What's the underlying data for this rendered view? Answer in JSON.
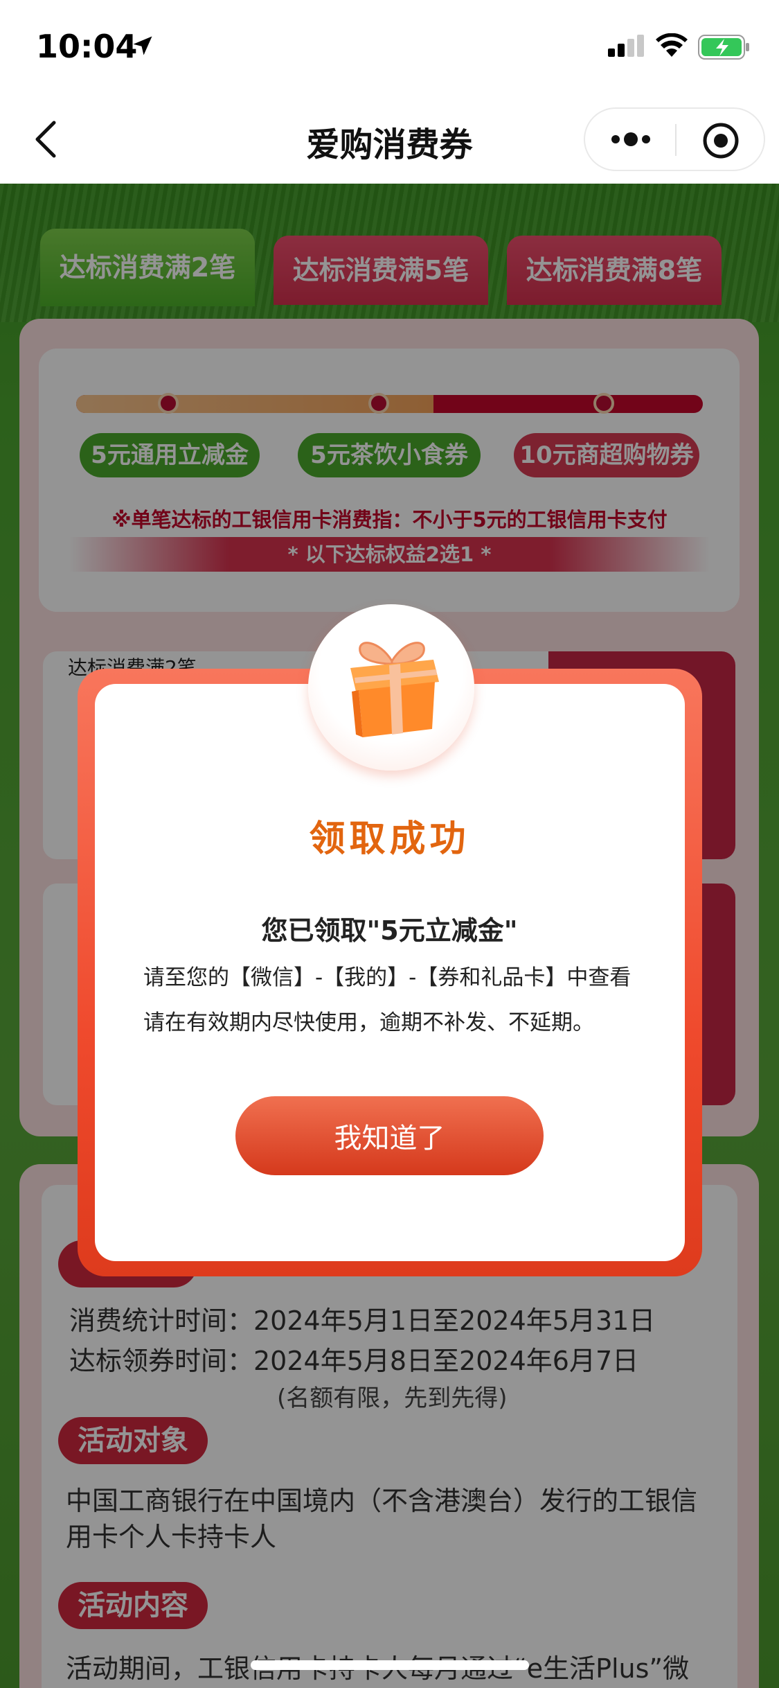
{
  "status": {
    "time": "10:04"
  },
  "nav": {
    "title": "爱购消费券"
  },
  "tabs": [
    {
      "label": "达标消费满2笔"
    },
    {
      "label": "达标消费满5笔"
    },
    {
      "label": "达标消费满8笔"
    }
  ],
  "rewards": {
    "pills": [
      "5元通用立减金",
      "5元茶饮小食券",
      "10元商超购物券"
    ],
    "progress_fraction": 0.57,
    "note": "※单笔达标的工银信用卡消费指：不小于5元的工银信用卡支付",
    "choose": "* 以下达标权益2选1 *",
    "card_title": "达标消费满2笔"
  },
  "rules": {
    "time_lines": [
      "消费统计时间：2024年5月1日至2024年5月31日",
      "达标领券时间：2024年5月8日至2024年6月7日",
      "(名额有限，先到先得)"
    ],
    "target_label": "活动对象",
    "target_text": "中国工商银行在中国境内（不含港澳台）发行的工银信用卡个人卡持卡人",
    "content_label": "活动内容",
    "content_text": "活动期间，工银信用卡持卡人每月通过“e生活Plus”微"
  },
  "modal": {
    "title": "领取成功",
    "claimed": "您已领取\"5元立减金\"",
    "hint_line1": "请至您的【微信】-【我的】-【券和礼品卡】中查看",
    "hint_line2": "请在有效期内尽快使用，逾期不补发、不延期。",
    "button": "我知道了"
  },
  "colors": {
    "accent": "#d5391c",
    "title_orange": "#e2650f",
    "green": "#4aa92c",
    "red": "#c4082c"
  }
}
